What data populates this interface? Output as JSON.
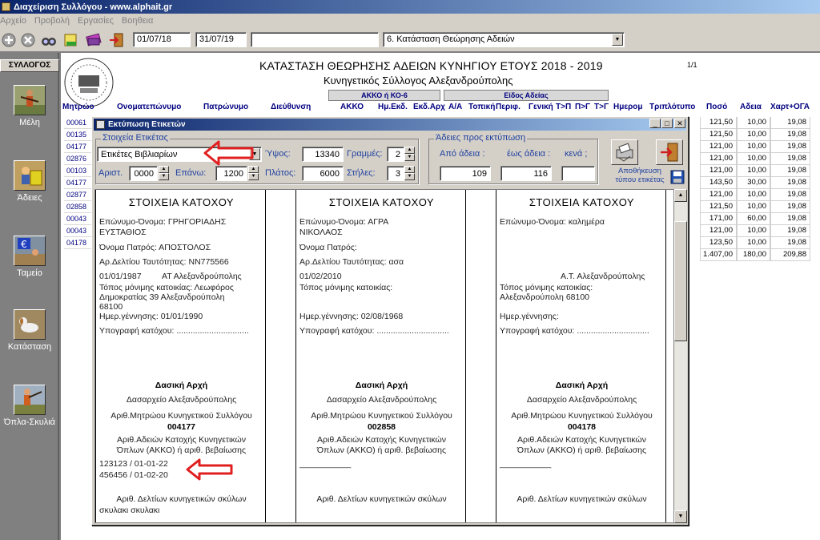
{
  "window": {
    "title": "Διαχείριση Συλλόγου -     www.alphait.gr"
  },
  "menu": [
    "Αρχείο",
    "Προβολή",
    "Εργασίες",
    "Βοηθεια"
  ],
  "toolbar": {
    "date_from": "01/07/18",
    "date_to": "31/07/19",
    "blank_field": "",
    "report_select": "6. Κατάσταση Θεώρησης Αδειών"
  },
  "sidebar": {
    "header": "ΣΥΛΛΟΓΟΣ",
    "items": [
      {
        "label": "Μέλη",
        "icon": "hunter-icon"
      },
      {
        "label": "Άδειες",
        "icon": "hunter-license-icon"
      },
      {
        "label": "Ταμείο",
        "icon": "euro-icon"
      },
      {
        "label": "Κατάσταση",
        "icon": "dog-icon"
      },
      {
        "label": "Όπλα-Σκυλιά",
        "icon": "gun-dog-icon"
      }
    ]
  },
  "report": {
    "title": "ΚΑΤΑΣΤΑΣΗ ΘΕΩΡΗΣΗΣ ΑΔΕΙΩΝ ΚΥΝΗΓΙΟΥ ΕΤΟΥΣ 2018 - 2019",
    "subtitle": "Κυνηγετικός Σύλλογος Αλεξανδρούπολης",
    "page": "1/1",
    "group_akko": "ΑΚΚΟ ή ΚΟ-6",
    "group_type": "Είδος Αδείας",
    "columns": [
      "Μητρώο",
      "Ονοματεπώνυμο",
      "Πατρώνυμο",
      "Διεύθυνση",
      "ΑΚΚΟ",
      "Ημ.Εκδ.",
      "Εκδ.Αρχ",
      "Α/Α",
      "Τοπική",
      "Περιφ.",
      "Γενική",
      "Τ>Π",
      "Π>Γ",
      "Τ>Γ",
      "Ημερομ",
      "Τριπλότυπο",
      "Ποσό",
      "Αδεια",
      "Χαρτ+ΟΓΑ"
    ],
    "row_ids": [
      "00061",
      "00135",
      "04177",
      "02876",
      "00103",
      "04177",
      "02877",
      "02858",
      "00043",
      "00043",
      "04178"
    ],
    "rows": [
      [
        "121,50",
        "10,00",
        "19,08"
      ],
      [
        "121,50",
        "10,00",
        "19,08"
      ],
      [
        "121,00",
        "10,00",
        "19,08"
      ],
      [
        "121,00",
        "10,00",
        "19,08"
      ],
      [
        "121,00",
        "10,00",
        "19,08"
      ],
      [
        "143,50",
        "30,00",
        "19,08"
      ],
      [
        "121,00",
        "10,00",
        "19,08"
      ],
      [
        "121,50",
        "10,00",
        "19,08"
      ],
      [
        "171,00",
        "60,00",
        "19,08"
      ],
      [
        "121,00",
        "10,00",
        "19,08"
      ],
      [
        "123,50",
        "10,00",
        "19,08"
      ]
    ],
    "totals": [
      "1.407,00",
      "180,00",
      "209,88"
    ]
  },
  "dialog": {
    "title": "Εκτύπωση Ετικετών",
    "label_group": "Στοιχεία Ετικέτας",
    "label_type": "Ετικέτες Βιβλιαρίων",
    "height_label": "Ύψος:",
    "height_value": "13340",
    "rows_label": "Γραμμές:",
    "rows_value": "2",
    "left_label": "Αριστ.",
    "left_value": "0000",
    "top_label": "Επάνω:",
    "top_value": "1200",
    "width_label": "Πλάτος:",
    "width_value": "6000",
    "cols_label": "Στήλες:",
    "cols_value": "3",
    "licenses_group": "Άδειες προς εκτύπωση",
    "from_label": "Από άδεια :",
    "to_label": "έως άδεια :",
    "blank_label": "κενά ;",
    "from_value": "109",
    "to_value": "116",
    "blank_value": "",
    "save_label": "Αποθήκευση τύπου ετικέτας"
  },
  "labels": [
    {
      "heading": "ΣΤΟΙΧΕΙΑ ΚΑΤΟΧΟΥ",
      "name_line1": "Επώνυμο-Όνομα: ΓΡΗΓΟΡΙΑΔΗΣ",
      "name_line2": "ΕΥΣΤΑΘΙΟΣ",
      "father": "Όνομα Πατρός: ΑΠΟΣΤΟΛΟΣ",
      "id_card": "Αρ.Δελτίου Ταυτότητας: ΝΝ775566",
      "date_issue": "01/01/1987",
      "authority": "ΑΤ Αλεξανδρούπολης",
      "residence1": "Τόπος μόνιμης κατοικίας: Λεωφόρος",
      "residence2": "Δημοκρατίας 39 Αλεξανδρούπολη",
      "residence3": "68100",
      "birth": "Ημερ.γέννησης: 01/01/1990",
      "signature": "Υπογραφή κατόχου: ...............................",
      "issuer_heading": "Δασική Αρχή",
      "issuer": "Δασαρχείο Αλεξανδρούπολης",
      "registry_label": "Αριθ.Μητρώου Κυνηγετικού Συλλόγου",
      "registry": "004177",
      "weapons1": "Αριθ.Αδειών Κατοχής Κυνηγετικών",
      "weapons2": "Όπλων (ΑΚΚΟ) ή αριθ. βεβαίωσης",
      "weapon_a": "123123 / 01-01-22",
      "weapon_b": "456456 / 01-02-20",
      "dogs_label": "Αριθ. Δελτίων κυνηγετικών σκύλων",
      "dogs": "σκυλακι σκυλακι"
    },
    {
      "heading": "ΣΤΟΙΧΕΙΑ ΚΑΤΟΧΟΥ",
      "name_line1": "Επώνυμο-Όνομα: ΑΓΡΑ",
      "name_line2": "ΝΙΚΟΛΑΟΣ",
      "father": "Όνομα Πατρός:",
      "id_card": "Αρ.Δελτίου Ταυτότητας: ασα",
      "date_issue": "01/02/2010",
      "residence1": "Τόπος μόνιμης κατοικίας:",
      "birth": "Ημερ.γέννησης: 02/08/1968",
      "signature": "Υπογραφή κατόχου: ...............................",
      "issuer_heading": "Δασική Αρχή",
      "issuer": "Δασαρχείο Αλεξανδρούπολης",
      "registry_label": "Αριθ.Μητρώου Κυνηγετικού Συλλόγου",
      "registry": "002858",
      "weapons1": "Αριθ.Αδειών Κατοχής Κυνηγετικών",
      "weapons2": "Όπλων (ΑΚΚΟ) ή αριθ. βεβαίωσης",
      "blank_line": "___________",
      "dogs_label": "Αριθ. Δελτίων κυνηγετικών σκύλων"
    },
    {
      "heading": "ΣΤΟΙΧΕΙΑ ΚΑΤΟΧΟΥ",
      "name_line1": "Επώνυμο-Όνομα: καλημέρα",
      "authority": "Α.Τ. Αλεξανδρούπολης",
      "residence1": "Τόπος μόνιμης κατοικίας:",
      "residence2": "Αλεξανδρούπολη 68100",
      "birth": "Ημερ.γέννησης:",
      "signature": "Υπογραφή κατόχου: ...............................",
      "issuer_heading": "Δασική Αρχή",
      "issuer": "Δασαρχείο Αλεξανδρούπολης",
      "registry_label": "Αριθ.Μητρώου Κυνηγετικού Συλλόγου",
      "registry": "004178",
      "weapons1": "Αριθ.Αδειών Κατοχής Κυνηγετικών",
      "weapons2": "Όπλων (ΑΚΚΟ) ή αριθ. βεβαίωσης",
      "blank_line": "___________",
      "dogs_label": "Αριθ. Δελτίων κυνηγετικών σκύλων"
    }
  ],
  "colors": {
    "title_blue": "#0a246a",
    "label_blue": "#2040a0",
    "arrow_red": "#e02020"
  }
}
